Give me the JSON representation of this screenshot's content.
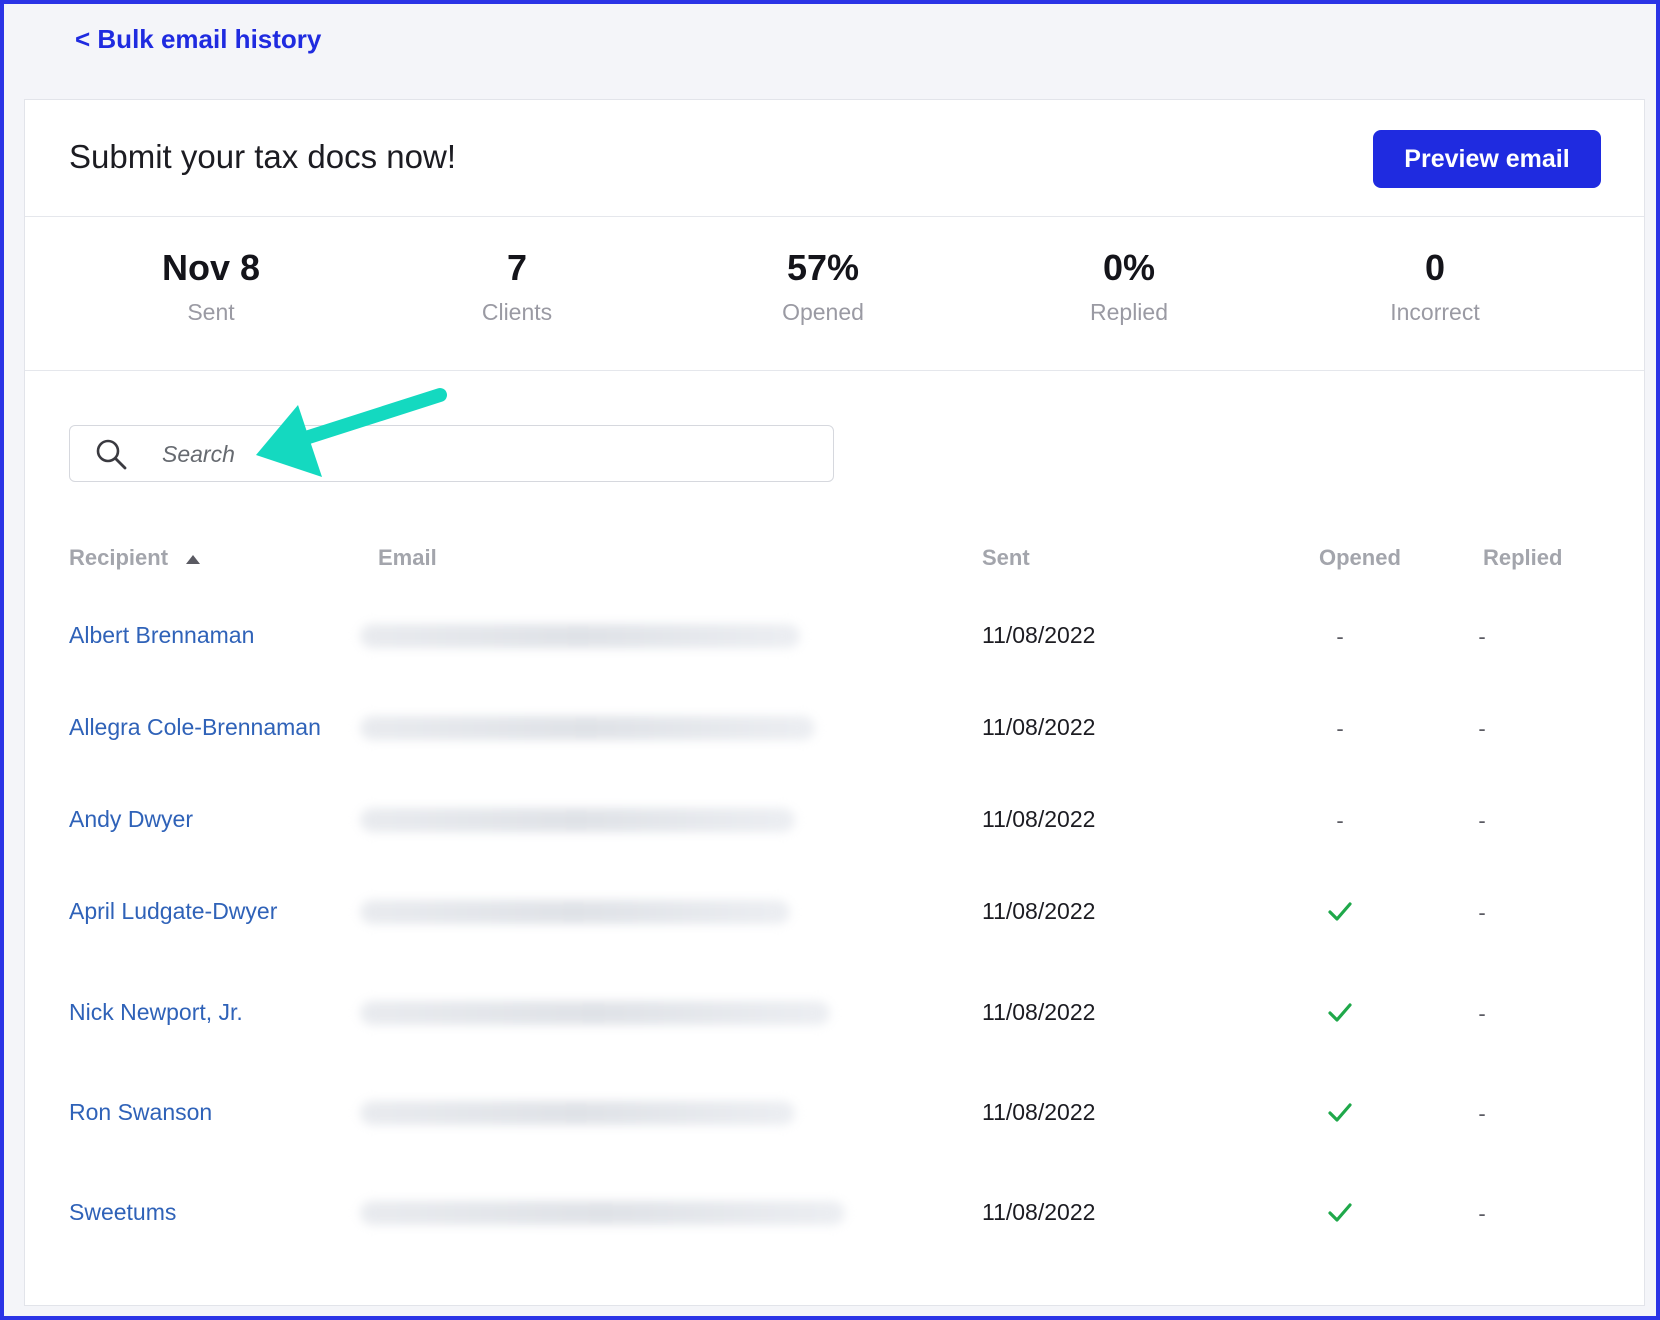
{
  "nav": {
    "back_label": "< Bulk email history"
  },
  "header": {
    "email_subject": "Submit your tax docs now!",
    "preview_button_label": "Preview email"
  },
  "stats": [
    {
      "value": "Nov 8",
      "label": "Sent"
    },
    {
      "value": "7",
      "label": "Clients"
    },
    {
      "value": "57%",
      "label": "Opened"
    },
    {
      "value": "0%",
      "label": "Replied"
    },
    {
      "value": "0",
      "label": "Incorrect"
    }
  ],
  "search": {
    "placeholder": "Search",
    "value": ""
  },
  "table": {
    "columns": {
      "recipient": "Recipient",
      "email": "Email",
      "sent": "Sent",
      "opened": "Opened",
      "replied": "Replied"
    },
    "sort": {
      "column": "recipient",
      "direction": "ascending"
    },
    "rows": [
      {
        "recipient": "Albert Brennaman",
        "sent": "11/08/2022",
        "opened": false,
        "replied": "-"
      },
      {
        "recipient": "Allegra Cole-Brennaman",
        "sent": "11/08/2022",
        "opened": false,
        "replied": "-"
      },
      {
        "recipient": "Andy Dwyer",
        "sent": "11/08/2022",
        "opened": false,
        "replied": "-"
      },
      {
        "recipient": "April Ludgate-Dwyer",
        "sent": "11/08/2022",
        "opened": true,
        "replied": "-"
      },
      {
        "recipient": "Nick Newport, Jr.",
        "sent": "11/08/2022",
        "opened": true,
        "replied": "-"
      },
      {
        "recipient": "Ron Swanson",
        "sent": "11/08/2022",
        "opened": true,
        "replied": "-"
      },
      {
        "recipient": "Sweetums",
        "sent": "11/08/2022",
        "opened": true,
        "replied": "-"
      }
    ],
    "not_opened_mark": "-"
  },
  "colors": {
    "accent": "#1f2be0",
    "link": "#2f62b8",
    "check": "#1fa84a",
    "annotation_arrow": "#14d9c0"
  }
}
